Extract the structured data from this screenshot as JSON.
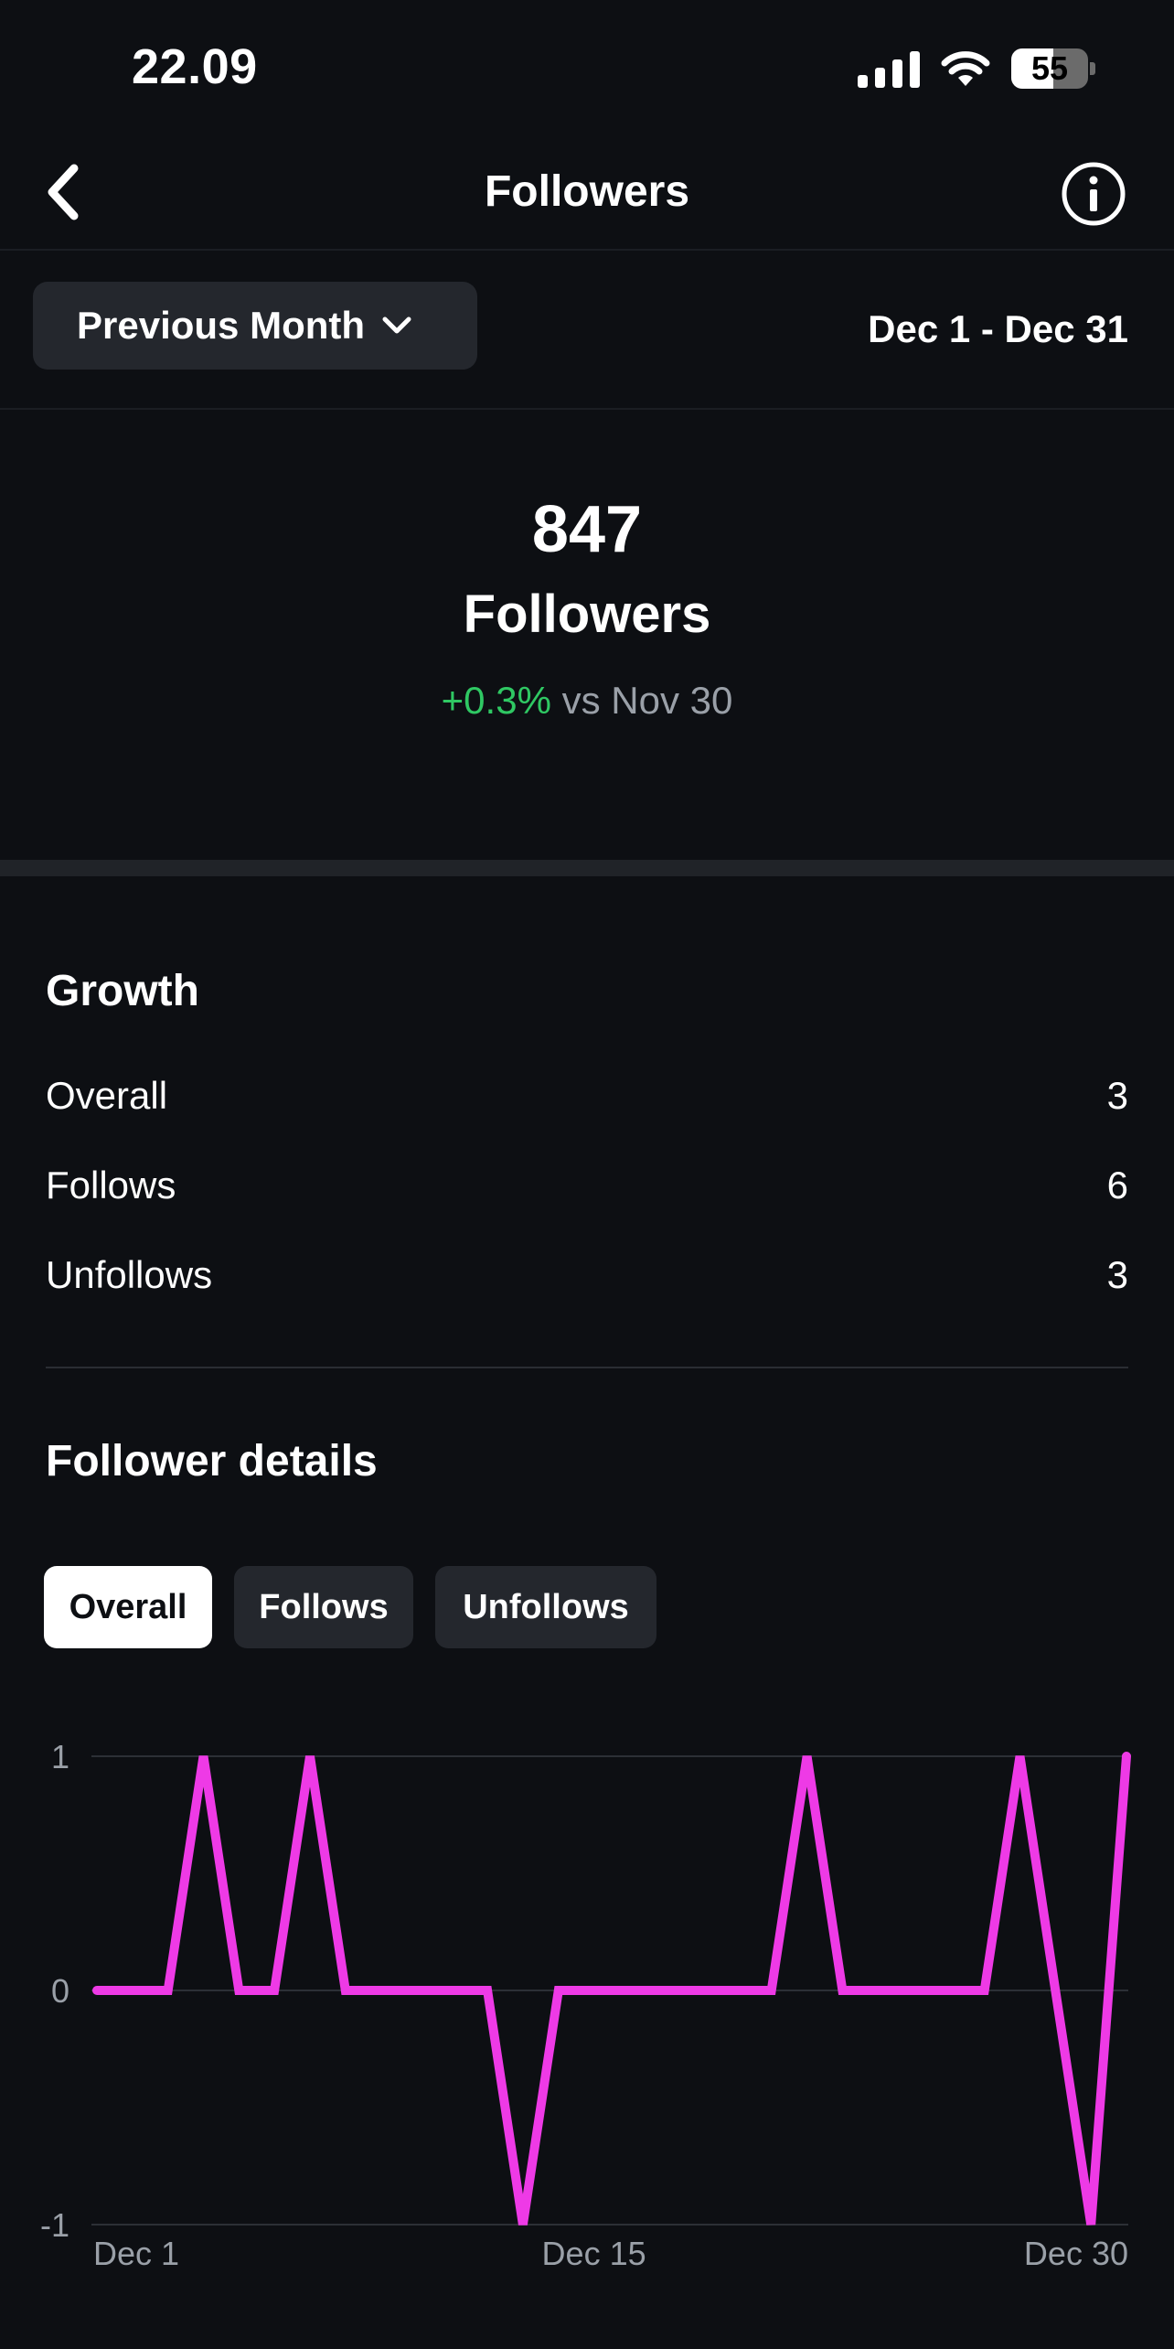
{
  "status_bar": {
    "time": "22.09",
    "battery": "55",
    "battery_level": 0.55
  },
  "nav": {
    "title": "Followers",
    "back_icon": "chevron-left-icon",
    "info_icon": "info-circle-icon"
  },
  "filter": {
    "period_label": "Previous Month",
    "date_range": "Dec 1 - Dec 31"
  },
  "summary": {
    "count": "847",
    "label": "Followers",
    "change_pct": "+0.3%",
    "change_ref": "vs Nov 30"
  },
  "growth": {
    "title": "Growth",
    "rows": [
      {
        "label": "Overall",
        "value": "3"
      },
      {
        "label": "Follows",
        "value": "6"
      },
      {
        "label": "Unfollows",
        "value": "3"
      }
    ]
  },
  "details": {
    "title": "Follower details",
    "tabs": [
      {
        "label": "Overall",
        "active": true
      },
      {
        "label": "Follows",
        "active": false
      },
      {
        "label": "Unfollows",
        "active": false
      }
    ]
  },
  "colors": {
    "line": "#ee3ae6",
    "positive": "#2fc863",
    "background": "#0d0f13"
  },
  "chart_data": {
    "type": "line",
    "x": [
      "Dec 1",
      "Dec 2",
      "Dec 3",
      "Dec 4",
      "Dec 5",
      "Dec 6",
      "Dec 7",
      "Dec 8",
      "Dec 9",
      "Dec 10",
      "Dec 11",
      "Dec 12",
      "Dec 13",
      "Dec 14",
      "Dec 15",
      "Dec 16",
      "Dec 17",
      "Dec 18",
      "Dec 19",
      "Dec 20",
      "Dec 21",
      "Dec 22",
      "Dec 23",
      "Dec 24",
      "Dec 25",
      "Dec 26",
      "Dec 27",
      "Dec 28",
      "Dec 29",
      "Dec 30"
    ],
    "series": [
      {
        "values": [
          0,
          0,
          0,
          1,
          0,
          0,
          1,
          0,
          0,
          0,
          0,
          0,
          -1,
          0,
          0,
          0,
          0,
          0,
          0,
          0,
          1,
          0,
          0,
          0,
          0,
          0,
          1,
          0,
          -1,
          1
        ]
      }
    ],
    "x_tick_labels": [
      "Dec 1",
      "Dec 15",
      "Dec 30"
    ],
    "y_tick_labels": [
      "1",
      "0",
      "-1"
    ],
    "ylim": [
      -1,
      1
    ],
    "grid": true
  }
}
